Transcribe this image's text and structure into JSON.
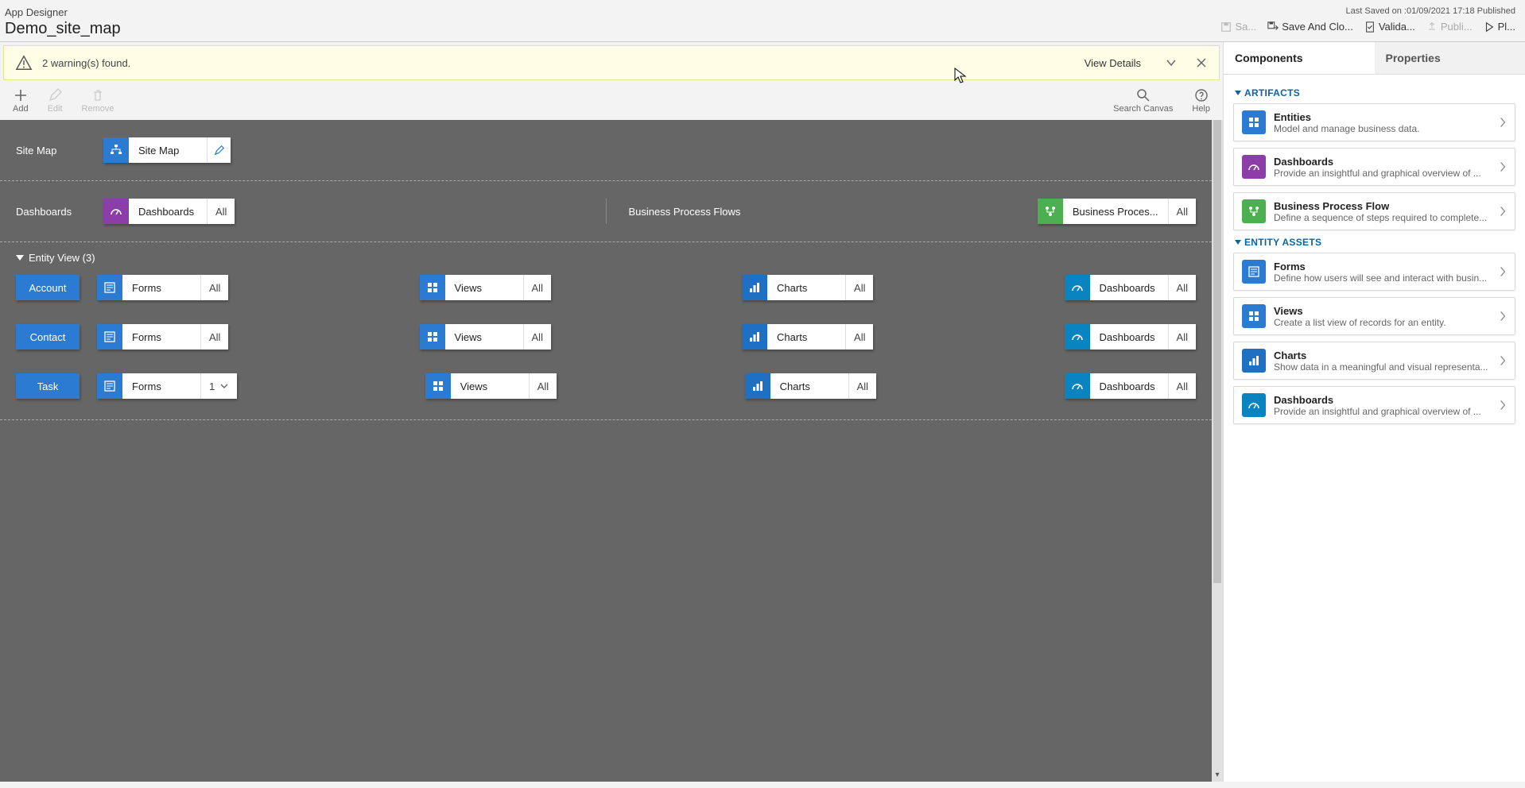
{
  "header": {
    "app_title": "App Designer",
    "page_title": "Demo_site_map",
    "last_saved": "Last Saved on :01/09/2021 17:18 Published",
    "actions": {
      "save": "Sa...",
      "save_close": "Save And Clo...",
      "validate": "Valida...",
      "publish": "Publi...",
      "play": "Pl..."
    }
  },
  "warning": {
    "text": "2 warning(s) found.",
    "view_details": "View Details"
  },
  "sec_toolbar": {
    "add": "Add",
    "edit": "Edit",
    "remove": "Remove",
    "search": "Search Canvas",
    "help": "Help"
  },
  "canvas": {
    "sitemap_label": "Site Map",
    "sitemap_tile": "Site Map",
    "dashboards_label": "Dashboards",
    "dashboards_tile": "Dashboards",
    "dashboards_tag": "All",
    "bpf_label": "Business Process Flows",
    "bpf_tile": "Business Proces...",
    "bpf_tag": "All",
    "entity_header": "Entity View (3)",
    "entities": [
      {
        "name": "Account",
        "forms": {
          "label": "Forms",
          "tag": "All"
        },
        "views": {
          "label": "Views",
          "tag": "All"
        },
        "charts": {
          "label": "Charts",
          "tag": "All"
        },
        "dash": {
          "label": "Dashboards",
          "tag": "All"
        }
      },
      {
        "name": "Contact",
        "forms": {
          "label": "Forms",
          "tag": "All"
        },
        "views": {
          "label": "Views",
          "tag": "All"
        },
        "charts": {
          "label": "Charts",
          "tag": "All"
        },
        "dash": {
          "label": "Dashboards",
          "tag": "All"
        }
      },
      {
        "name": "Task",
        "forms": {
          "label": "Forms",
          "tag": "1",
          "has_chevron": true
        },
        "views": {
          "label": "Views",
          "tag": "All"
        },
        "charts": {
          "label": "Charts",
          "tag": "All"
        },
        "dash": {
          "label": "Dashboards",
          "tag": "All"
        }
      }
    ]
  },
  "panel": {
    "tabs": {
      "components": "Components",
      "properties": "Properties"
    },
    "sections": {
      "artifacts": "ARTIFACTS",
      "entity_assets": "ENTITY ASSETS"
    },
    "artifacts": [
      {
        "title": "Entities",
        "desc": "Model and manage business data.",
        "color": "#2a7bd1",
        "icon": "grid"
      },
      {
        "title": "Dashboards",
        "desc": "Provide an insightful and graphical overview of ...",
        "color": "#8d3da8",
        "icon": "gauge"
      },
      {
        "title": "Business Process Flow",
        "desc": "Define a sequence of steps required to complete...",
        "color": "#4caf50",
        "icon": "flow"
      }
    ],
    "entity_assets": [
      {
        "title": "Forms",
        "desc": "Define how users will see and interact with busin...",
        "color": "#2a7bd1",
        "icon": "form"
      },
      {
        "title": "Views",
        "desc": "Create a list view of records for an entity.",
        "color": "#2a7bd1",
        "icon": "grid"
      },
      {
        "title": "Charts",
        "desc": "Show data in a meaningful and visual representa...",
        "color": "#1f6fc2",
        "icon": "chart"
      },
      {
        "title": "Dashboards",
        "desc": "Provide an insightful and graphical overview of ...",
        "color": "#0a84c1",
        "icon": "gauge"
      }
    ]
  }
}
